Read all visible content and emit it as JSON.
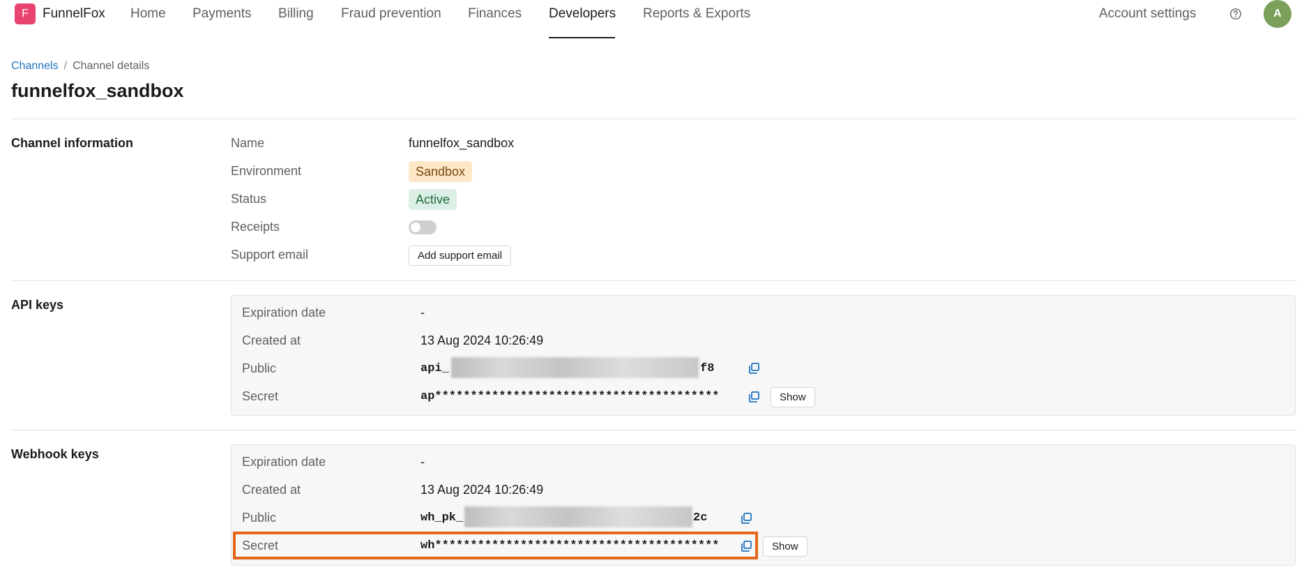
{
  "app": {
    "logo_letter": "F",
    "name": "FunnelFox",
    "brand_color": "#e8446f"
  },
  "nav": {
    "items": [
      "Home",
      "Payments",
      "Billing",
      "Fraud prevention",
      "Finances",
      "Developers",
      "Reports & Exports"
    ],
    "active": "Developers",
    "account_settings": "Account settings",
    "help_icon": "help-circle-icon",
    "avatar_initial": "A"
  },
  "breadcrumb": {
    "link": "Channels",
    "separator": "/",
    "current": "Channel details"
  },
  "page_title": "funnelfox_sandbox",
  "channel_info": {
    "title": "Channel information",
    "name_label": "Name",
    "name_value": "funnelfox_sandbox",
    "environment_label": "Environment",
    "environment_value": "Sandbox",
    "status_label": "Status",
    "status_value": "Active",
    "receipts_label": "Receipts",
    "receipts_enabled": false,
    "support_email_label": "Support email",
    "add_support_email_button": "Add support email"
  },
  "api_keys": {
    "title": "API keys",
    "expiration_label": "Expiration date",
    "expiration_value": "-",
    "created_label": "Created at",
    "created_value": "13 Aug 2024 10:26:49",
    "public_label": "Public",
    "public_prefix": "api_",
    "public_suffix": "f8",
    "secret_label": "Secret",
    "secret_value": "ap****************************************",
    "show_button": "Show"
  },
  "webhook_keys": {
    "title": "Webhook keys",
    "expiration_label": "Expiration date",
    "expiration_value": "-",
    "created_label": "Created at",
    "created_value": "13 Aug 2024 10:26:49",
    "public_label": "Public",
    "public_prefix": "wh_pk_",
    "public_suffix": "2c",
    "secret_label": "Secret",
    "secret_value": "wh****************************************",
    "show_button": "Show"
  },
  "colors": {
    "accent_link": "#1e73be",
    "highlight_outline": "#e4661a",
    "sandbox_badge": "#fde7c7",
    "active_badge": "#dcefe4"
  }
}
